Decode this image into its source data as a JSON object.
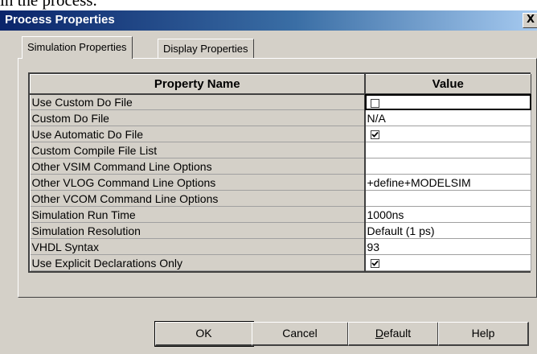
{
  "top_text": "in the process.",
  "dialog": {
    "title": "Process Properties",
    "close_label": "X"
  },
  "tabs": [
    {
      "label": "Simulation Properties",
      "active": true
    },
    {
      "label": "Display Properties",
      "active": false
    }
  ],
  "table": {
    "headers": {
      "name": "Property Name",
      "value": "Value"
    },
    "rows": [
      {
        "name": "Use Custom Do File",
        "value": "",
        "type": "checkbox",
        "checked": false
      },
      {
        "name": "Custom Do File",
        "value": "N/A",
        "type": "text"
      },
      {
        "name": "Use Automatic Do File",
        "value": "",
        "type": "checkbox",
        "checked": true
      },
      {
        "name": "Custom Compile File List",
        "value": "",
        "type": "text"
      },
      {
        "name": "Other VSIM Command Line Options",
        "value": "",
        "type": "text"
      },
      {
        "name": "Other VLOG Command Line Options",
        "value": "+define+MODELSIM",
        "type": "text"
      },
      {
        "name": "Other VCOM Command Line Options",
        "value": "",
        "type": "text"
      },
      {
        "name": "Simulation Run Time",
        "value": "1000ns",
        "type": "text"
      },
      {
        "name": "Simulation Resolution",
        "value": "Default (1 ps)",
        "type": "text"
      },
      {
        "name": "VHDL Syntax",
        "value": "93",
        "type": "text"
      },
      {
        "name": "Use Explicit Declarations Only",
        "value": "",
        "type": "checkbox",
        "checked": true
      }
    ]
  },
  "buttons": {
    "ok": "OK",
    "cancel": "Cancel",
    "default_first": "D",
    "default_rest": "efault",
    "help": "Help"
  }
}
